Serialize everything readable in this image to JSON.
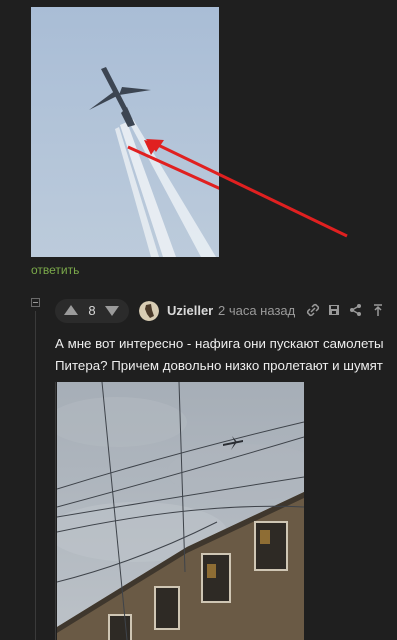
{
  "post": {
    "reply_label": "ответить"
  },
  "comment": {
    "rating": "8",
    "username": "Uzieller",
    "timestamp": "2 часа назад",
    "text_line1": "А мне вот интересно - нафига они пускают самолеты",
    "text_line2": "Питера? Причем довольно низко пролетают и шумят"
  },
  "colors": {
    "background": "#1f1f1f",
    "reply_link": "#7cab4b",
    "arrow": "#e02020"
  },
  "icons": [
    "collapse-icon",
    "upvote-icon",
    "downvote-icon",
    "link-icon",
    "save-icon",
    "share-icon",
    "scroll-top-icon"
  ]
}
